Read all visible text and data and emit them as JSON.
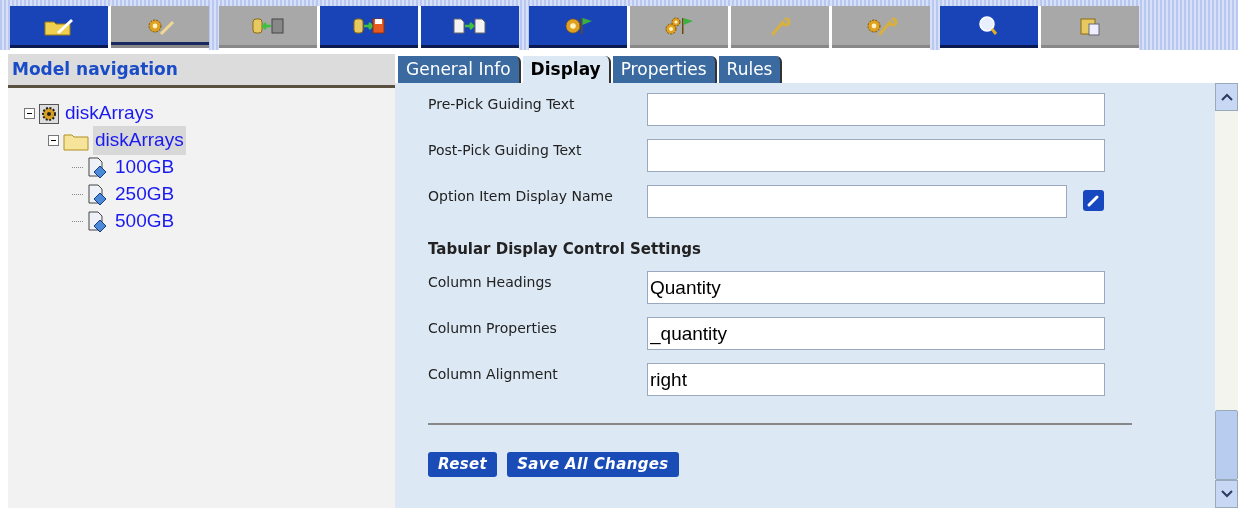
{
  "toolbar": {
    "groups": [
      [
        {
          "kind": "folder-pencil",
          "active": true,
          "selected": false
        },
        {
          "kind": "gear-pencil",
          "active": false,
          "selected": true
        }
      ],
      [
        {
          "kind": "database-from-floppy",
          "active": false,
          "selected": false
        },
        {
          "kind": "database-to-floppy",
          "active": true,
          "selected": false
        },
        {
          "kind": "document-to-document",
          "active": true,
          "selected": false
        }
      ],
      [
        {
          "kind": "gear-flag",
          "active": true,
          "selected": false
        },
        {
          "kind": "gears-flag",
          "active": false,
          "selected": false
        },
        {
          "kind": "wrench",
          "active": false,
          "selected": false
        },
        {
          "kind": "gear-wrench",
          "active": false,
          "selected": false
        }
      ],
      [
        {
          "kind": "search",
          "active": true,
          "selected": false
        },
        {
          "kind": "clipboard",
          "active": false,
          "selected": false
        }
      ]
    ]
  },
  "navigation": {
    "title": "Model navigation",
    "tree": [
      {
        "label": "diskArrays",
        "kind": "model",
        "expanded": true,
        "selected": false,
        "children": [
          {
            "label": "diskArrays",
            "kind": "folder",
            "expanded": true,
            "selected": true,
            "children": [
              {
                "label": "100GB",
                "kind": "item",
                "selected": false
              },
              {
                "label": "250GB",
                "kind": "item",
                "selected": false
              },
              {
                "label": "500GB",
                "kind": "item",
                "selected": false
              }
            ]
          }
        ]
      }
    ]
  },
  "tabs": [
    {
      "label": "General Info",
      "selected": false
    },
    {
      "label": "Display",
      "selected": true
    },
    {
      "label": "Properties",
      "selected": false
    },
    {
      "label": "Rules",
      "selected": false
    }
  ],
  "form": {
    "fields": [
      {
        "label": "Pre-Pick Guiding Text",
        "editable_name": false
      },
      {
        "label": "Post-Pick Guiding Text",
        "editable_name": false
      },
      {
        "label": "Option Item Display Name",
        "editable_name": true
      }
    ],
    "section_title": "Tabular Display Control Settings",
    "table_fields": [
      {
        "label": "Column Headings",
        "value": "Quantity"
      },
      {
        "label": "Column Properties",
        "value": "_quantity"
      },
      {
        "label": "Column Alignment",
        "value": "right"
      }
    ],
    "buttons": [
      "Reset",
      "Save All Changes"
    ]
  }
}
